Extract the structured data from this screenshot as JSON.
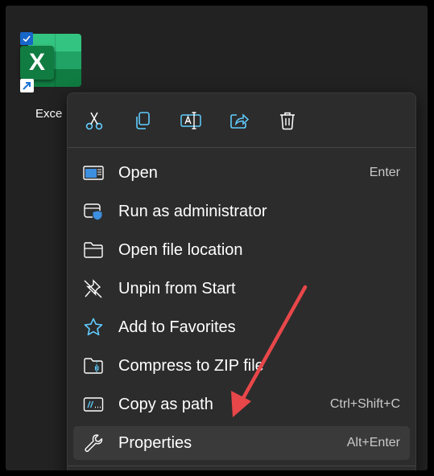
{
  "desktop": {
    "icon_label": "Exce"
  },
  "toolbar": {
    "cut": "cut-icon",
    "copy": "copy-icon",
    "rename": "rename-icon",
    "share": "share-icon",
    "delete": "delete-icon"
  },
  "menu": {
    "items": [
      {
        "label": "Open",
        "accel": "Enter",
        "icon": "open-icon"
      },
      {
        "label": "Run as administrator",
        "accel": "",
        "icon": "shield-icon"
      },
      {
        "label": "Open file location",
        "accel": "",
        "icon": "folder-icon"
      },
      {
        "label": "Unpin from Start",
        "accel": "",
        "icon": "unpin-icon"
      },
      {
        "label": "Add to Favorites",
        "accel": "",
        "icon": "star-icon"
      },
      {
        "label": "Compress to ZIP file",
        "accel": "",
        "icon": "zip-icon"
      },
      {
        "label": "Copy as path",
        "accel": "Ctrl+Shift+C",
        "icon": "copy-path-icon"
      },
      {
        "label": "Properties",
        "accel": "Alt+Enter",
        "icon": "wrench-icon",
        "selected": true
      }
    ]
  },
  "colors": {
    "accent": "#60cdff",
    "arrow": "#e8474a",
    "menu_bg": "#2c2c2c",
    "selected_bg": "#3a3a3a"
  }
}
